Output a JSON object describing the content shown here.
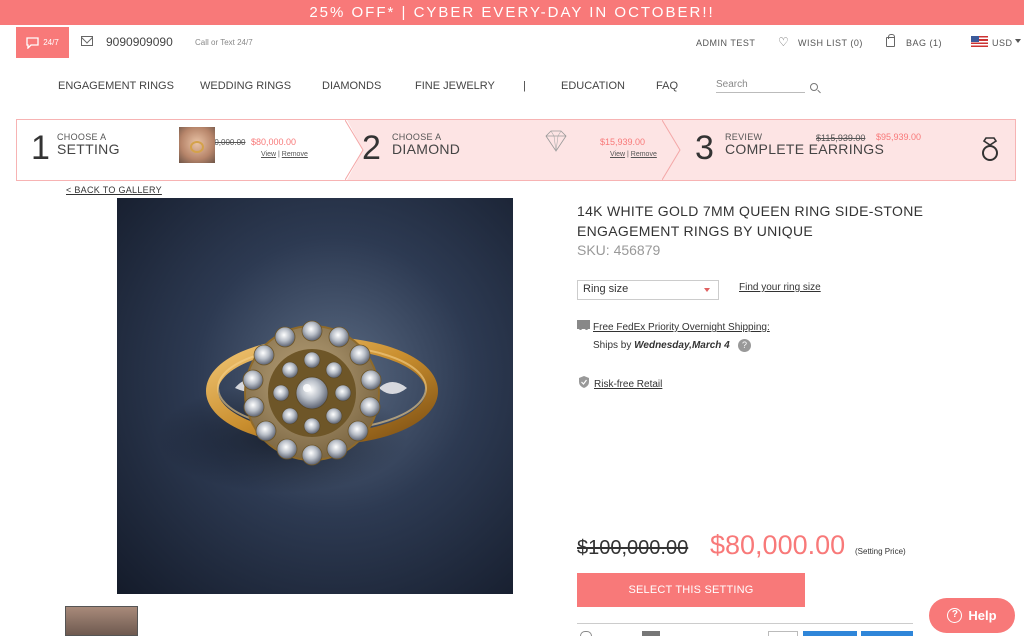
{
  "promo": {
    "text": "25% OFF* | CYBER EVERY-DAY IN OCTOBER!!"
  },
  "topbar": {
    "chat_label": "24/7",
    "phone": "9090909090",
    "call_text": "Call or Text 24/7",
    "user": "ADMIN TEST",
    "wishlist": "WISH LIST (0)",
    "bag": "BAG  (1)",
    "currency": "USD"
  },
  "nav": {
    "items": [
      "ENGAGEMENT RINGS",
      "WEDDING RINGS",
      "DIAMONDS",
      "FINE JEWELRY",
      "|",
      "EDUCATION",
      "FAQ"
    ],
    "search_placeholder": "Search"
  },
  "steps": [
    {
      "num": "1",
      "small": "CHOOSE A",
      "big": "SETTING",
      "old_price": "$100,000.00",
      "price": "$80,000.00",
      "view": "View",
      "sep": "|",
      "remove": "Remove"
    },
    {
      "num": "2",
      "small": "CHOOSE A",
      "big": "DIAMOND",
      "price": "$15,939.00",
      "view": "View",
      "sep": "|",
      "remove": "Remove"
    },
    {
      "num": "3",
      "small": "REVIEW",
      "big": "COMPLETE EARRINGS",
      "old_price": "$115,939.00",
      "price": "$95,939.00"
    }
  ],
  "back_link": "< BACK TO GALLERY",
  "product": {
    "title": "14K WHITE GOLD 7MM QUEEN RING SIDE-STONE ENGAGEMENT RINGS BY UNIQUE",
    "sku": "SKU: 456879",
    "ring_size_label": "Ring size",
    "find_size": "Find your ring size",
    "shipping_link": "Free FedEx Priority Overnight Shipping:",
    "ships_by_prefix": "Ships by ",
    "ships_by_date": "Wednesday,March 4",
    "help_q": "?",
    "risk_free": "Risk-free Retail",
    "old_price": "$100,000.00",
    "price": "$80,000.00",
    "price_note": "(Setting Price)",
    "select_button": "SELECT THIS SETTING"
  },
  "help_button": "Help",
  "colors": {
    "accent": "#f87979",
    "accent_light": "#fde4e4"
  }
}
